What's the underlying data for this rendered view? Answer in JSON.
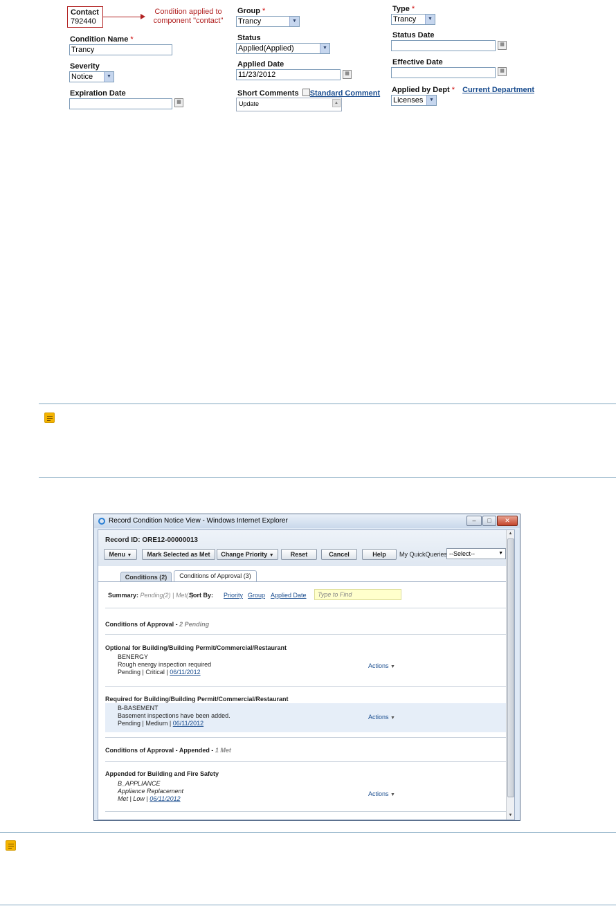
{
  "form": {
    "contact": {
      "label": "Contact",
      "value": "792440"
    },
    "annotation": {
      "line1": "Condition applied to",
      "line2": "component \"contact\""
    },
    "group": {
      "label": "Group",
      "value": "Trancy"
    },
    "type": {
      "label": "Type",
      "value": "Trancy"
    },
    "condition_name": {
      "label": "Condition Name",
      "value": "Trancy"
    },
    "status": {
      "label": "Status",
      "value": "Applied(Applied)"
    },
    "status_date": {
      "label": "Status Date",
      "value": ""
    },
    "severity": {
      "label": "Severity",
      "value": "Notice"
    },
    "applied_date": {
      "label": "Applied Date",
      "value": "11/23/2012"
    },
    "effective_date": {
      "label": "Effective Date",
      "value": ""
    },
    "expiration_date": {
      "label": "Expiration Date",
      "value": ""
    },
    "short_comments": {
      "label": "Short Comments",
      "value": "Update",
      "link": "Standard Comment"
    },
    "applied_by_dept": {
      "label": "Applied by Dept",
      "value": "Licenses",
      "link": "Current Department"
    },
    "required_mark": "*",
    "calendar_icon": "calendar-icon"
  },
  "window": {
    "title": "Record Condition Notice View - Windows Internet Explorer",
    "controls": {
      "minimize": "–",
      "maximize": "□",
      "close": "✕"
    },
    "record_id": "Record ID: ORE12-00000013",
    "toolbar": {
      "menu": "Menu",
      "mark_met": "Mark Selected as Met",
      "change_priority": "Change Priority",
      "reset": "Reset",
      "cancel": "Cancel",
      "help": "Help",
      "quickqueries_label": "My QuickQueries",
      "quickqueries_value": "--Select--"
    },
    "tabs": [
      {
        "label": "Conditions (2)",
        "active": false
      },
      {
        "label": "Conditions of Approval (3)",
        "active": true
      }
    ],
    "summary": {
      "label": "Summary:",
      "pending": "Pending(2)",
      "separator": "|",
      "met": "Met(1)",
      "sort_by": "Sort By:",
      "sort_priority": "Priority",
      "sort_group": "Group",
      "sort_applied_date": "Applied Date",
      "find_placeholder": "Type to Find"
    },
    "sections": [
      {
        "title": "Conditions of Approval -",
        "meta": "2 Pending"
      },
      {
        "title": "Conditions of Approval - Appended -",
        "meta": "1 Met"
      }
    ],
    "groups": [
      {
        "title": "Optional for Building/Building Permit/Commercial/Restaurant",
        "name": "BENERGY",
        "description": "Rough energy inspection required",
        "status_line": "Pending | Critical |",
        "date": "06/11/2012",
        "actions": "Actions"
      },
      {
        "title": "Required for Building/Building Permit/Commercial/Restaurant",
        "name": "B-BASEMENT",
        "description": "Basement inspections have been added.",
        "status_line": "Pending | Medium |",
        "date": "06/11/2012",
        "actions": "Actions"
      },
      {
        "title": "Appended for Building and Fire Safety",
        "name": "B_APPLIANCE",
        "description": "Appliance Replacement",
        "status_line": "Met | Low |",
        "date": "06/11/2012",
        "actions": "Actions"
      }
    ]
  }
}
